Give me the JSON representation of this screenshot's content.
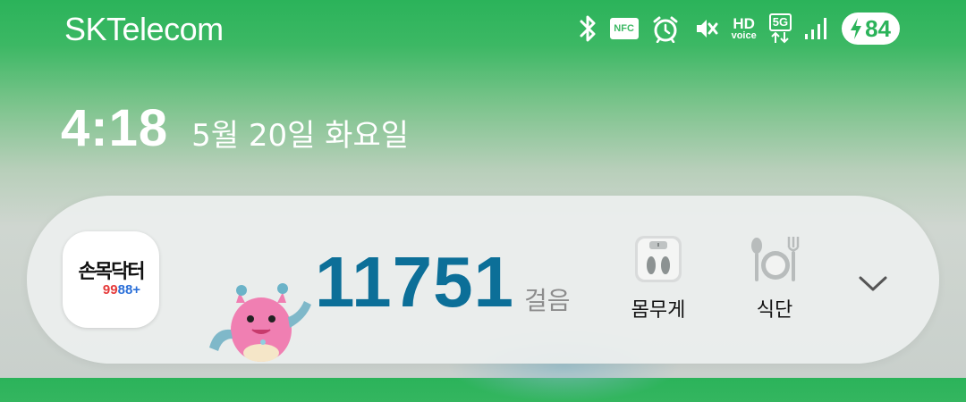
{
  "status_bar": {
    "carrier": "SKTelecom",
    "icons": [
      "bluetooth-icon",
      "nfc-icon",
      "alarm-icon",
      "vibrate-icon",
      "hd-voice-icon",
      "5g-icon",
      "signal-icon",
      "battery-icon"
    ],
    "nfc_label": "NFC",
    "hd_top": "HD",
    "hd_bottom": "voice",
    "network": "5G",
    "battery_percent": "84",
    "battery_charging": true
  },
  "lockscreen": {
    "time": "4:18",
    "date": "5월 20일 화요일"
  },
  "widget": {
    "app_name_line1": "손목닥터",
    "app_name_line2_red": "99",
    "app_name_line2_blue": "88",
    "app_name_line2_plus": "+",
    "steps": "11751",
    "steps_unit": "걸음",
    "actions": [
      {
        "label": "몸무게",
        "icon": "scale-icon"
      },
      {
        "label": "식단",
        "icon": "meal-icon"
      }
    ],
    "expand_icon": "chevron-down-icon"
  },
  "colors": {
    "accent_green": "#2bb35a",
    "steps_blue": "#0c6f98"
  }
}
